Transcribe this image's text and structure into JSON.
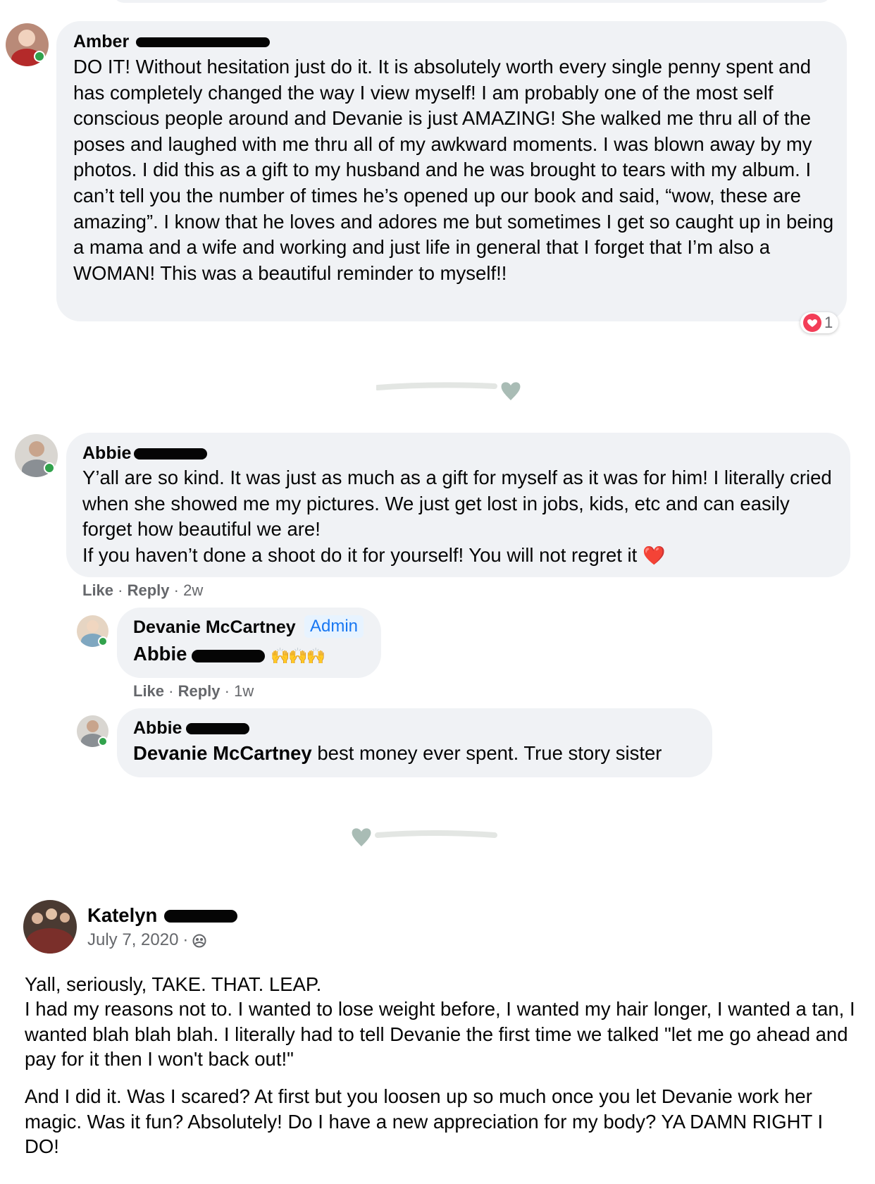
{
  "comment1": {
    "name": "Amber",
    "text": "DO IT! Without hesitation just do it. It is absolutely worth every single penny spent and has completely changed the way I view myself! I am probably one of the most self conscious people around and Devanie is just AMAZING! She walked me thru all of the poses and laughed with me thru all of my awkward moments. I was blown away by my photos. I did this as a gift to my husband and he was brought to tears with my album. I can’t tell you the number of times he’s opened up our book and said, “wow, these are amazing”. I know that he loves and adores me but sometimes I get so caught up in being a mama and a wife and working and just life in general that I forget that I’m also a WOMAN! This was a beautiful reminder to myself!!",
    "reaction_count": "1"
  },
  "comment2": {
    "name": "Abbie",
    "text_lines": [
      "Y’all are so kind. It was just as much as a gift for myself as it was for him! I literally cried when she showed me my pictures. We just get lost in jobs, kids, etc and can easily forget how beautiful we are!",
      "If you haven’t done a shoot do it for yourself! You will not regret it"
    ],
    "emoji": "❤️",
    "like": "Like",
    "reply": "Reply",
    "time": "2w"
  },
  "reply1": {
    "name": "Devanie McCartney",
    "badge": "Admin",
    "mention": "Abbie",
    "emoji": "🙌🙌🙌",
    "like": "Like",
    "reply": "Reply",
    "time": "1w"
  },
  "reply2": {
    "name": "Abbie",
    "mention": "Devanie McCartney",
    "text": "best money ever spent. True story sister"
  },
  "post": {
    "name": "Katelyn",
    "date": "July 7, 2020",
    "privacy_icon": "friends-icon",
    "para1_lines": [
      "Yall, seriously, TAKE. THAT. LEAP.",
      "I had my reasons not to. I wanted to lose weight before, I wanted my hair longer, I wanted a tan, I wanted blah blah blah. I literally had to tell Devanie the first time we talked \"let me go ahead and pay for it then I won't back out!\""
    ],
    "para2": "And I did it. Was I scared? At first but you loosen up so much once you let Devanie work her magic. Was it fun? Absolutely! Do I have a new appreciation for my body? YA DAMN RIGHT I DO!"
  },
  "colors": {
    "bubble": "#f0f2f5",
    "online": "#31a24c",
    "accent": "#1877f2",
    "divider": "#e3e6e3",
    "heart": "#a9bcb5"
  }
}
